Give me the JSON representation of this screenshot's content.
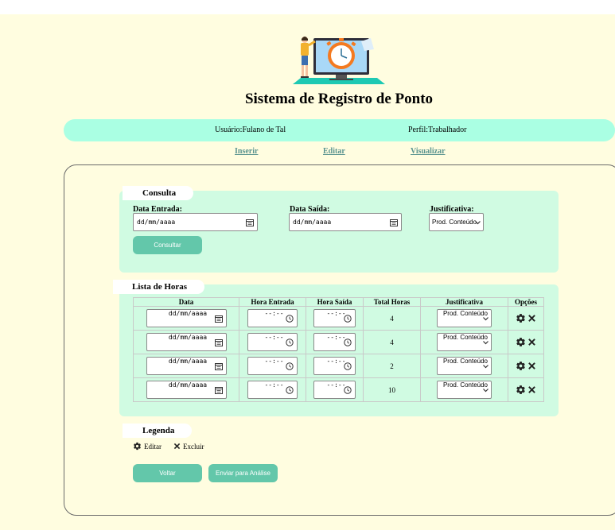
{
  "app": {
    "title": "Sistema de Registro de Ponto"
  },
  "userbar": {
    "user": "Usuário:Fulano de Tal",
    "profile": "Perfil:Trabalhador"
  },
  "nav": {
    "insert": "Inserir",
    "edit": "Editar",
    "view": "Visualizar"
  },
  "consulta": {
    "legend": "Consulta",
    "entry_label": "Data Entrada:",
    "exit_label": "Data Saída:",
    "just_label": "Justificativa:",
    "date_placeholder": "dd/mm/aaaa",
    "just_value": "Prod. Conteúdo",
    "submit": "Consultar"
  },
  "hours": {
    "legend": "Lista de Horas",
    "columns": [
      "Data",
      "Hora Entrada",
      "Hora Saída",
      "Total Horas",
      "Justificativa",
      "Opções"
    ],
    "rows": [
      {
        "date": "dd/mm/aaaa",
        "in": "--:--",
        "out": "--:--",
        "total": "4",
        "just": "Prod. Conteúdo"
      },
      {
        "date": "dd/mm/aaaa",
        "in": "--:--",
        "out": "--:--",
        "total": "4",
        "just": "Prod. Conteúdo"
      },
      {
        "date": "dd/mm/aaaa",
        "in": "--:--",
        "out": "--:--",
        "total": "2",
        "just": "Prod. Conteúdo"
      },
      {
        "date": "dd/mm/aaaa",
        "in": "--:--",
        "out": "--:--",
        "total": "10",
        "just": "Prod. Conteúdo"
      }
    ]
  },
  "legenda": {
    "legend": "Legenda",
    "edit": "Editar",
    "delete": "Excluir"
  },
  "actions": {
    "back": "Voltar",
    "send": "Enviar para Análise"
  },
  "icons": {
    "edit": "gear-icon",
    "delete": "close-icon",
    "date": "calendar-icon",
    "time": "clock-icon",
    "dropdown": "chevron-down-icon"
  },
  "colors": {
    "accent": "#63c7aa",
    "userbar": "#aaffe3",
    "panel": "#d0fbe2",
    "background": "#fffde0",
    "link": "#5b9490"
  }
}
